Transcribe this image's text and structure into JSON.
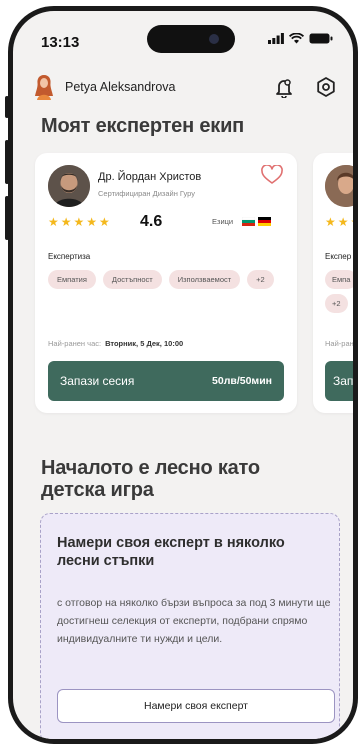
{
  "status_bar": {
    "time": "13:13"
  },
  "header": {
    "user_name": "Petya Aleksandrova"
  },
  "team_section": {
    "title": "Моят експертен екип"
  },
  "expert_card": {
    "name": "Др. Йордан Христов",
    "subtitle": "Сертифициран Дизайн Гуру",
    "stars": "★★★★★",
    "rating": "4.6",
    "rating_value": 4.6,
    "languages_label": "Езици",
    "expertise_label": "Експертиза",
    "tags": [
      "Емпатия",
      "Достъпност",
      "Използваемост",
      "+2"
    ],
    "earliest_label": "Най-ранен час:",
    "earliest_value": "Вторник, 5 Дек, 10:00",
    "book_label": "Запази сесия",
    "price": "50лв/50мин"
  },
  "peek_card": {
    "stars": "★★★",
    "expertise_label": "Експер",
    "tag": "Емпа",
    "tag2": "+2",
    "earliest_label": "Най-ран",
    "book_label": "Запа"
  },
  "easy_section": {
    "title_line1": "Началото е лесно като",
    "title_line2": "детска игра"
  },
  "info_box": {
    "title": "Намери своя експерт в няколко лесни стъпки",
    "text": "с отговор на няколко бързи въпроса за под 3 минути ще достигнеш селекция от експерти, подбрани спрямо индивидуалните ти нужди и цели.",
    "button_label": "Намери своя експерт"
  },
  "colors": {
    "accent_green": "#3f6a5d",
    "tag_bg": "#f4e1e1",
    "star": "#f4b81d",
    "info_bg": "#eeeaf8",
    "heart": "#e07070"
  }
}
